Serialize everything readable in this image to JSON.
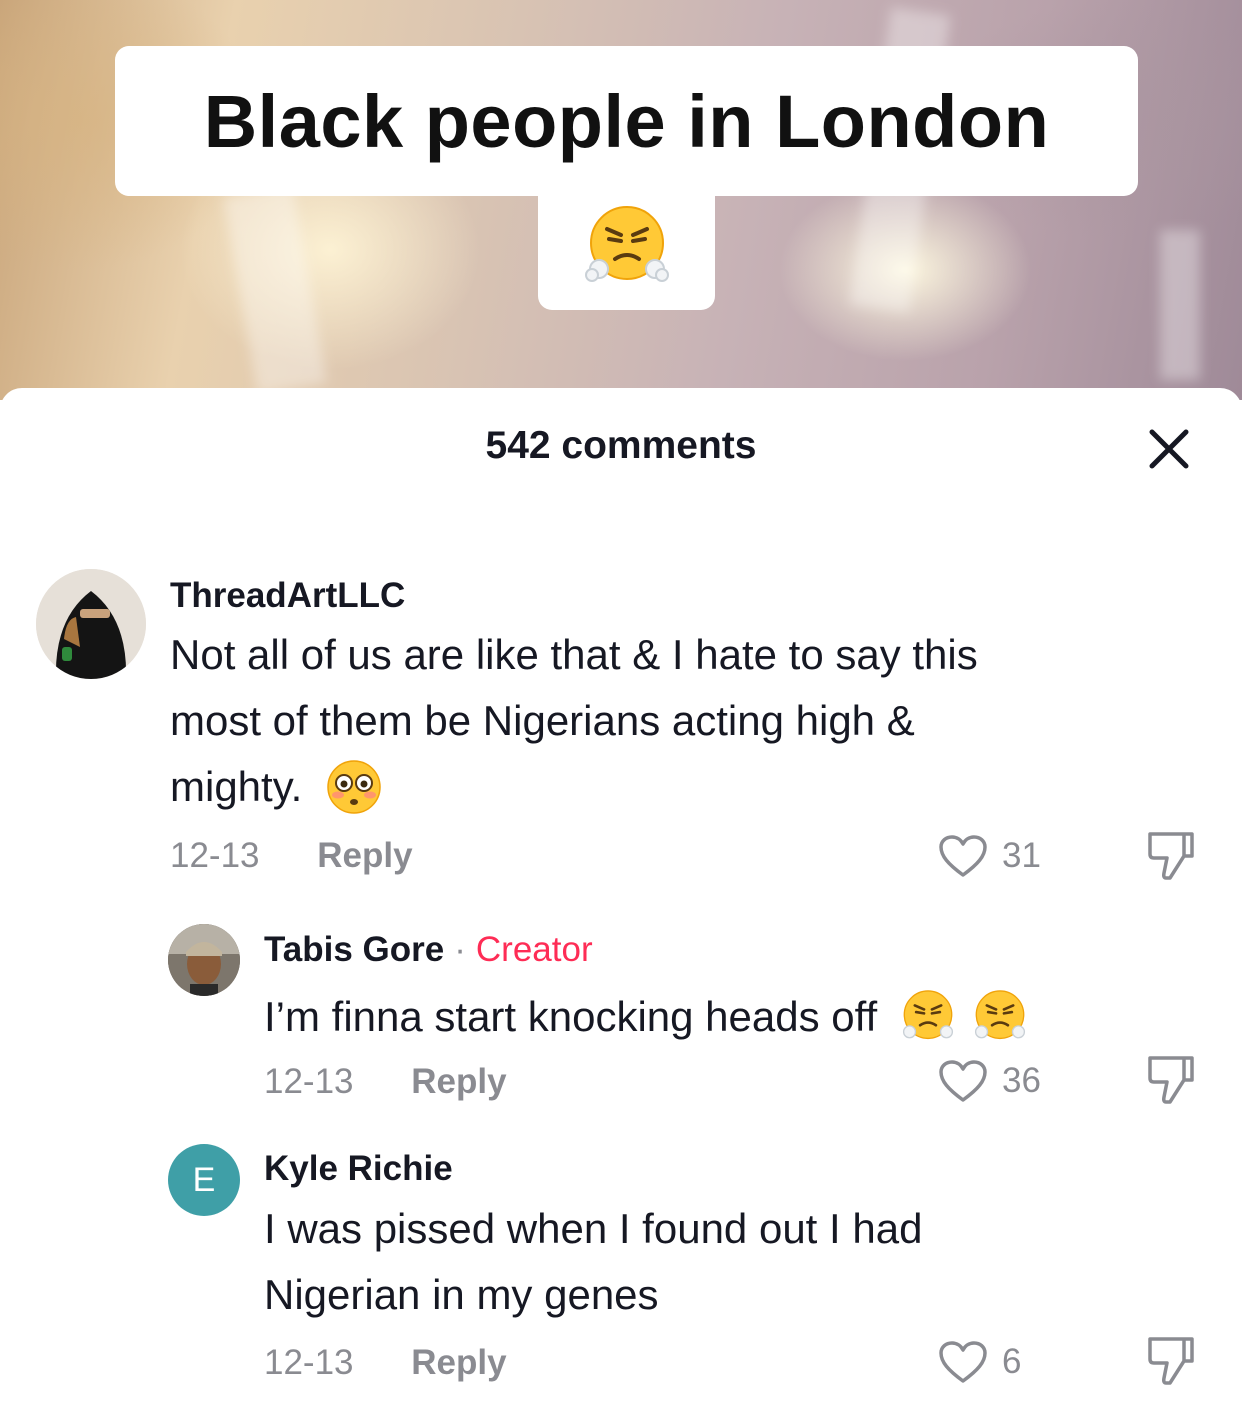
{
  "video": {
    "caption": "Black people in London",
    "caption_emoji": "face-with-steam-from-nose"
  },
  "sheet": {
    "title": "542 comments"
  },
  "comments": [
    {
      "username": "ThreadArtLLC",
      "text_lines": [
        "Not all of us are like that & I hate to say this",
        "most of them be Nigerians acting high &",
        "mighty."
      ],
      "emoji": "flushed-face",
      "date": "12-13",
      "reply_label": "Reply",
      "likes": "31"
    },
    {
      "username": "Tabis Gore",
      "badge": "Creator",
      "text": "I’m finna start knocking heads off",
      "emoji": "face-with-steam-from-nose x2",
      "date": "12-13",
      "reply_label": "Reply",
      "likes": "36"
    },
    {
      "username": "Kyle Richie",
      "avatar_letter": "E",
      "avatar_color": "#3f9fa7",
      "text_lines": [
        "I was pissed when I found out I had",
        "Nigerian in my genes"
      ],
      "date": "12-13",
      "reply_label": "Reply",
      "likes": "6"
    }
  ],
  "colors": {
    "accent_creator": "#fe2c55",
    "secondary_text": "#8a8b91"
  }
}
